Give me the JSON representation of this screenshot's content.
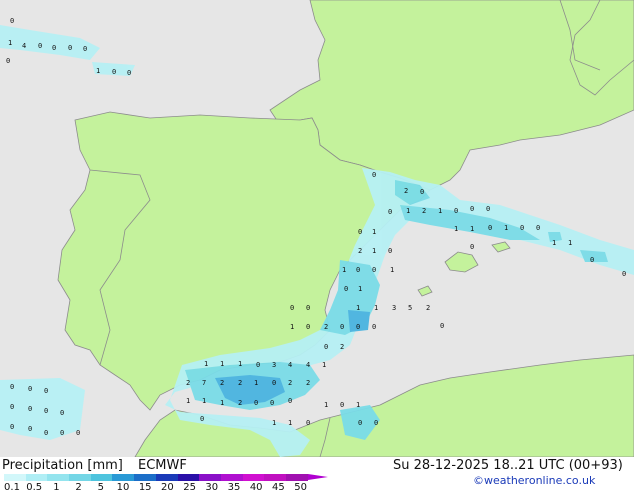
{
  "title": "Precipitation [mm]",
  "model": "ECMWF",
  "datetime": "Su 28-12-2025 18..21 UTC (00+93)",
  "credit": "©weatheronline.co.uk",
  "colors": {
    "sea": "#e6e6e6",
    "land": "#c4f29c",
    "border": "#8c8c8c",
    "precip_light": "#b6f0f4",
    "precip_mid": "#7adce8",
    "precip_heavy": "#4ab4e0"
  },
  "legend": [
    {
      "label": "0.1",
      "color": "#d2f7fa"
    },
    {
      "label": "0.5",
      "color": "#b0eef5"
    },
    {
      "label": "1",
      "color": "#94e4ee"
    },
    {
      "label": "2",
      "color": "#74d6e6"
    },
    {
      "label": "5",
      "color": "#4ec4de"
    },
    {
      "label": "10",
      "color": "#2a9ad6"
    },
    {
      "label": "15",
      "color": "#1c6ec8"
    },
    {
      "label": "20",
      "color": "#1a3ab8"
    },
    {
      "label": "25",
      "color": "#2a10a8"
    },
    {
      "label": "30",
      "color": "#8a10c8"
    },
    {
      "label": "35",
      "color": "#b010d0"
    },
    {
      "label": "40",
      "color": "#d010d0"
    },
    {
      "label": "45",
      "color": "#c010c0"
    },
    {
      "label": "50",
      "color": "#a010b0"
    }
  ],
  "values": [
    "0",
    "1",
    "4",
    "0",
    "0",
    "0",
    "0",
    "0",
    "1",
    "0",
    "0",
    "0",
    "2",
    "0",
    "0",
    "1",
    "2",
    "1",
    "0",
    "0",
    "0",
    "1",
    "1",
    "0",
    "1",
    "0",
    "0",
    "1",
    "1",
    "0",
    "0",
    "0",
    "0",
    "1",
    "2",
    "1",
    "0",
    "1",
    "0",
    "0",
    "1",
    "0",
    "1",
    "0",
    "0",
    "1",
    "1",
    "3",
    "5",
    "2",
    "1",
    "0",
    "2",
    "0",
    "0",
    "0",
    "0",
    "0",
    "2",
    "1",
    "1",
    "1",
    "0",
    "3",
    "4",
    "4",
    "1",
    "2",
    "7",
    "2",
    "2",
    "1",
    "0",
    "2",
    "2",
    "1",
    "1",
    "1",
    "2",
    "0",
    "0",
    "0",
    "0",
    "1",
    "1",
    "0",
    "1",
    "0",
    "1",
    "0",
    "0",
    "0",
    "0",
    "0",
    "0",
    "0",
    "0",
    "0",
    "0",
    "0",
    "0",
    "0",
    "0"
  ]
}
